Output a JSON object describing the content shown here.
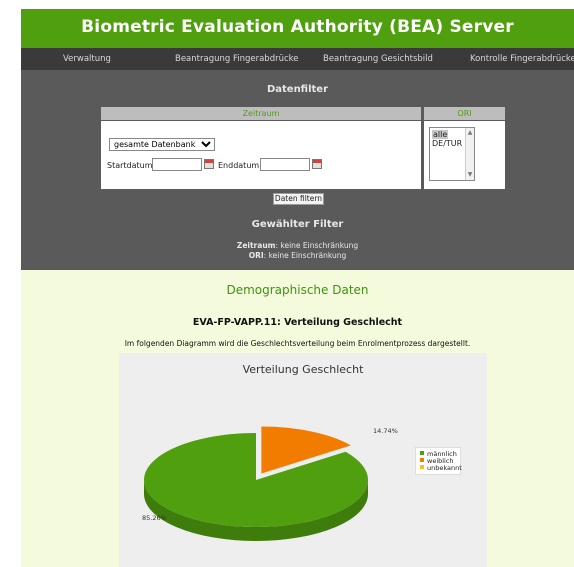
{
  "header": {
    "title": "Biometric Evaluation Authority (BEA) Server"
  },
  "nav": {
    "items": [
      {
        "label": "Verwaltung"
      },
      {
        "label": "Beantragung Fingerabdrücke"
      },
      {
        "label": "Beantragung Gesichtsbild"
      },
      {
        "label": "Kontrolle Fingerabdrücke"
      }
    ]
  },
  "filter": {
    "heading": "Datenfilter",
    "zeitraum_header": "Zeitraum",
    "ori_header": "ORI",
    "db_select": "gesamte Datenbank",
    "start_label": "Startdatum:",
    "end_label": "Enddatum:",
    "start_value": "",
    "end_value": "",
    "ori_options": [
      "alle",
      "DE/TUR"
    ],
    "ori_selected": "alle",
    "button": "Daten filtern",
    "chosen_heading": "Gewählter Filter",
    "crit_zeitraum_label": "Zeitraum",
    "crit_zeitraum_value": ": keine Einschränkung",
    "crit_ori_label": "ORI",
    "crit_ori_value": ": keine Einschränkung"
  },
  "content": {
    "section_title": "Demographische Daten",
    "chart_heading": "EVA-FP-VAPP.11: Verteilung Geschlecht",
    "description": "Im folgenden Diagramm wird die Geschlechtsverteilung beim Enrolmentprozess dargestellt."
  },
  "colors": {
    "green": "#4f9f0e",
    "orange": "#f27c00",
    "yellow": "#f0c419"
  },
  "chart_data": {
    "type": "pie",
    "title": "Verteilung Geschlecht",
    "categories": [
      "männlich",
      "weiblich",
      "unbekannt"
    ],
    "values": [
      85.26,
      14.74,
      0
    ],
    "labels": [
      "85.26%",
      "14.74%"
    ],
    "colors": [
      "#4f9f0e",
      "#f27c00",
      "#f0c419"
    ],
    "legend_position": "right"
  }
}
